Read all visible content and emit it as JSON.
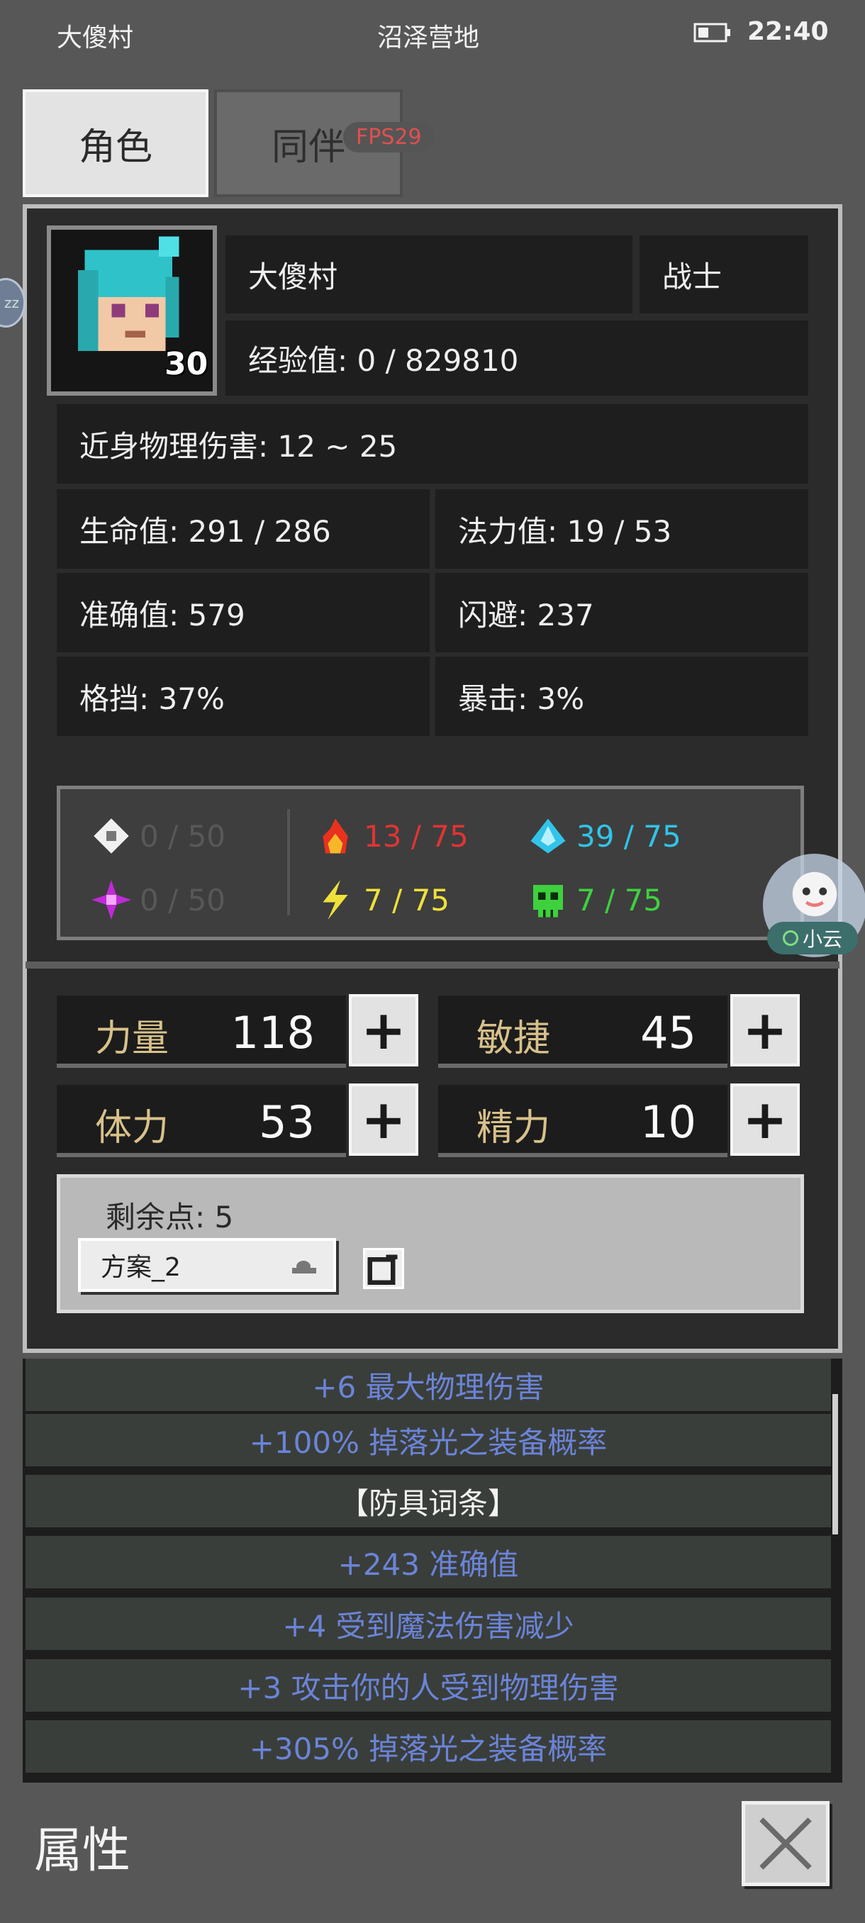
{
  "status_bar": {
    "left": "大傻村",
    "center": "沼泽营地",
    "time": "22:40"
  },
  "tabs": {
    "character": "角色",
    "companion": "同伴",
    "fps": "FPS29"
  },
  "hero": {
    "name": "大傻村",
    "class": "战士",
    "level": "30",
    "exp": "经验值: 0 / 829810"
  },
  "stats": {
    "melee": "近身物理伤害: 12 ~ 25",
    "hp": "生命值: 291 / 286",
    "mp": "法力值: 19 / 53",
    "accuracy": "准确值: 579",
    "dodge": "闪避: 237",
    "block": "格挡: 37%",
    "crit": "暴击: 3%"
  },
  "resistances": {
    "physical": "0 / 50",
    "fire": "13 / 75",
    "ice": "39 / 75",
    "arcane": "0 / 50",
    "lightning": "7 / 75",
    "poison": "7 / 75"
  },
  "colors": {
    "fire": "#e03434",
    "ice": "#31c4e8",
    "lightning": "#f0e13a",
    "poison": "#3ed13e",
    "dim": "#585858",
    "affix": "#6b84d8"
  },
  "attributes": [
    {
      "label": "力量",
      "value": "118"
    },
    {
      "label": "敏捷",
      "value": "45"
    },
    {
      "label": "体力",
      "value": "53"
    },
    {
      "label": "精力",
      "value": "10"
    }
  ],
  "remaining": "剩余点: 5",
  "plan": "方案_2",
  "affix_list": [
    {
      "text": "+6 最大物理伤害",
      "kind": "affix"
    },
    {
      "text": "+100% 掉落光之装备概率",
      "kind": "affix"
    },
    {
      "text": "【防具词条】",
      "kind": "header"
    },
    {
      "text": "+243 准确值",
      "kind": "affix"
    },
    {
      "text": "+4 受到魔法伤害减少",
      "kind": "affix"
    },
    {
      "text": "+3 攻击你的人受到物理伤害",
      "kind": "affix"
    },
    {
      "text": "+305% 掉落光之装备概率",
      "kind": "affix"
    }
  ],
  "footer": {
    "title": "属性"
  },
  "overlay": {
    "assistant_badge": "小云",
    "zz": "zz"
  }
}
